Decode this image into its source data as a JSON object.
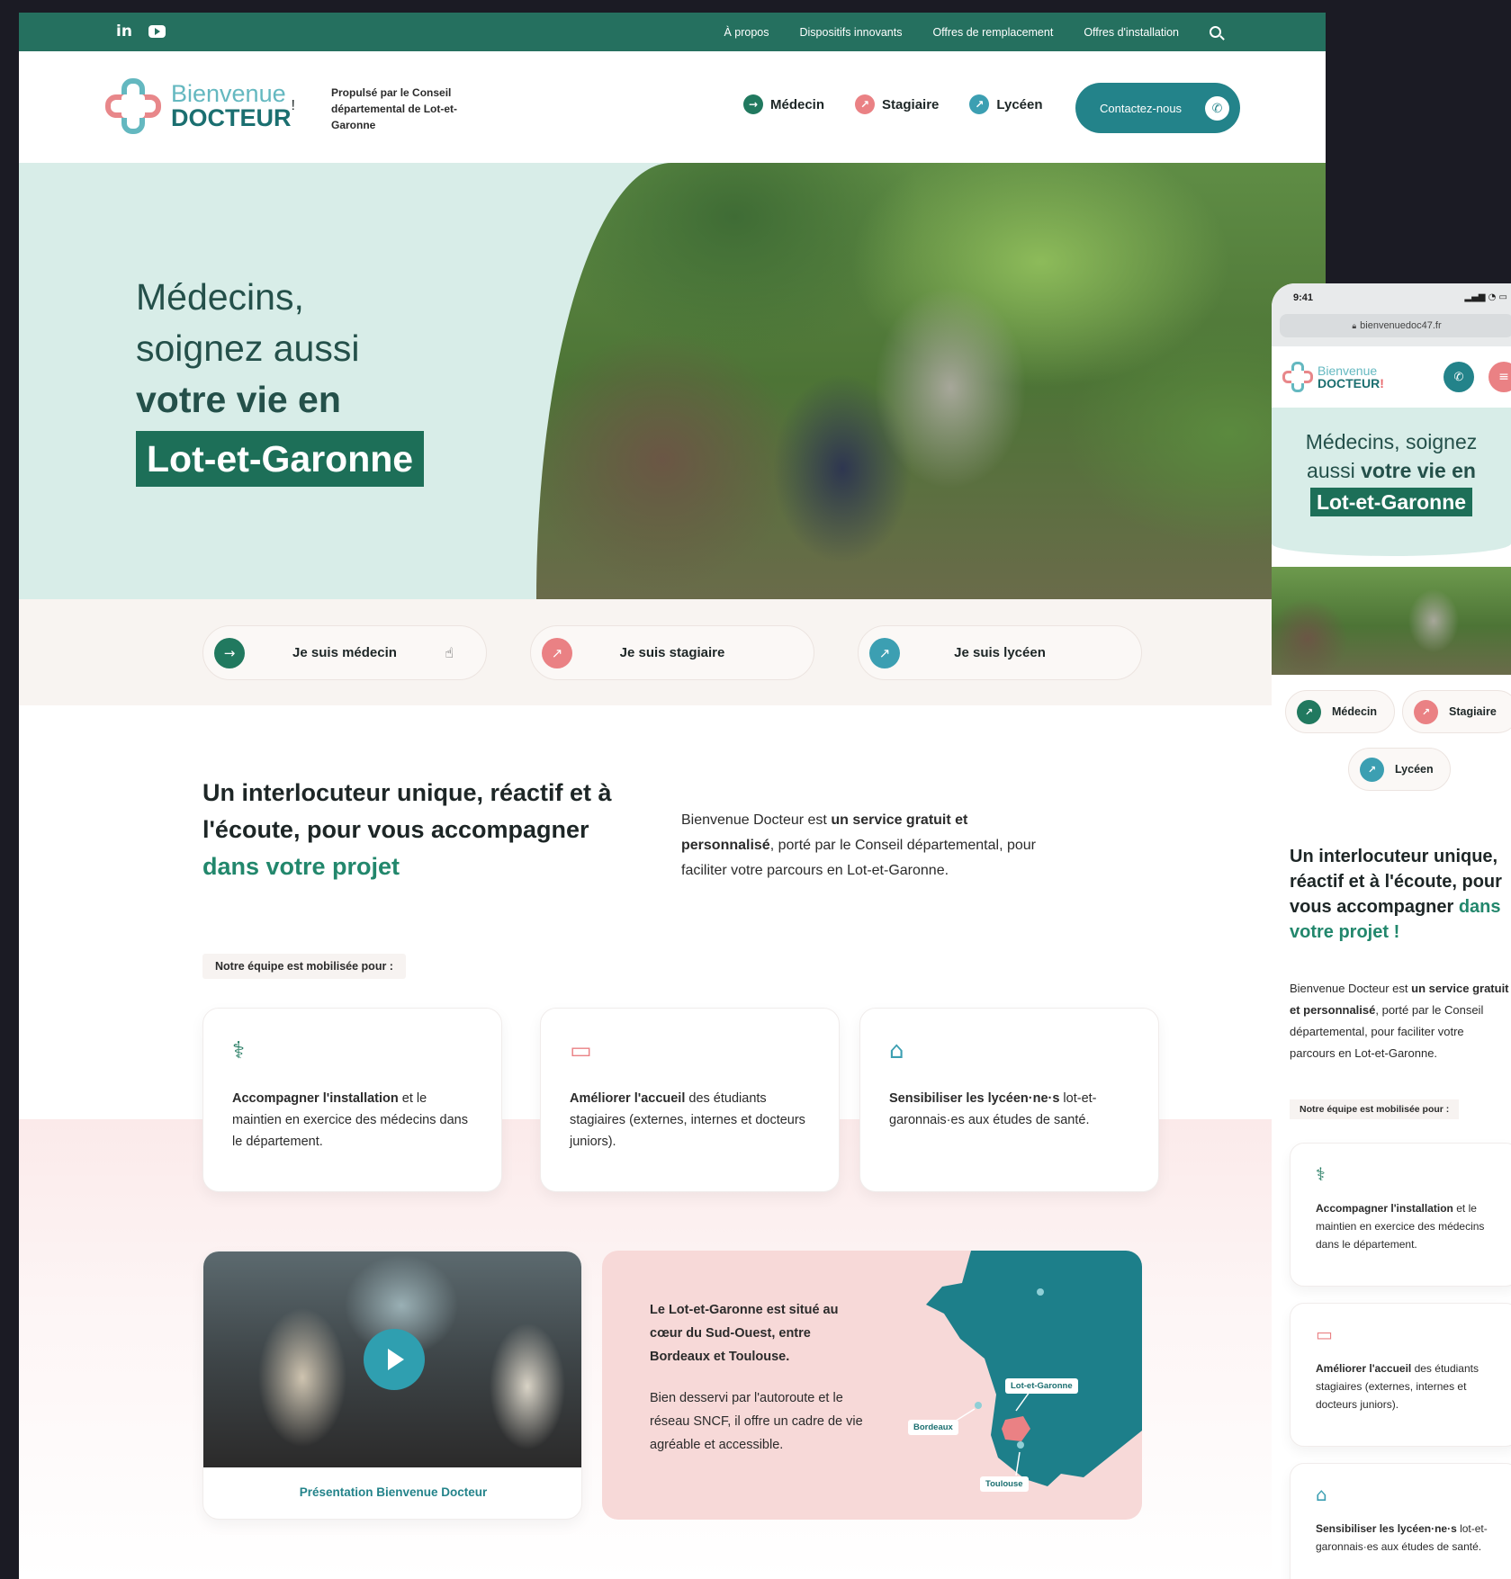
{
  "desktop": {
    "topbar": {
      "social": [
        "in",
        "youtube"
      ],
      "nav": [
        "À propos",
        "Dispositifs innovants",
        "Offres de remplacement",
        "Offres d'installation"
      ]
    },
    "header": {
      "logo_line1": "Bienvenue",
      "logo_line2": "DOCTEUR",
      "logo_bang": "!",
      "powered_by": "Propulsé par le Conseil départemental de Lot-et-Garonne",
      "nav": [
        {
          "label": "Médecin",
          "icon": "arrow-right-icon"
        },
        {
          "label": "Stagiaire",
          "icon": "arrow-up-right-icon"
        },
        {
          "label": "Lycéen",
          "icon": "arrow-up-right-icon"
        }
      ],
      "contact_label": "Contactez-nous"
    },
    "hero": {
      "line1": "Médecins,",
      "line2": "soignez aussi",
      "line3": "votre vie en",
      "tag": "Lot-et-Garonne"
    },
    "profiles": [
      {
        "label": "Je suis médecin"
      },
      {
        "label": "Je suis stagiaire"
      },
      {
        "label": "Je suis lycéen"
      }
    ],
    "intro": {
      "heading_main": "Un interlocuteur unique, réactif et à l'écoute, pour vous accompagner ",
      "heading_accent": "dans votre projet",
      "p_part1": "Bienvenue Docteur est ",
      "p_bold": "un service gratuit et personnalisé",
      "p_part2": ", porté par le Conseil départemental, pour faciliter votre parcours en Lot-et-Garonne."
    },
    "mobilised_label": "Notre équipe est mobilisée pour :",
    "cards": [
      {
        "icon": "stethoscope-icon",
        "bold": "Accompagner l'installation",
        "rest": " et le maintien en exercice des médecins dans le département."
      },
      {
        "icon": "student-card-icon",
        "bold": "Améliorer l'accueil",
        "rest": " des étudiants stagiaires (externes, internes et docteurs juniors)."
      },
      {
        "icon": "backpack-icon",
        "bold": "Sensibiliser les lycéen·ne·s",
        "rest": " lot-et-garonnais·es aux études de santé."
      }
    ],
    "video_caption": "Présentation Bienvenue Docteur",
    "map": {
      "text1": "Le Lot-et-Garonne est situé au cœur du Sud-Ouest, entre Bordeaux et Toulouse.",
      "text2": "Bien desservi par l'autoroute et le réseau SNCF, il offre un cadre de vie agréable et accessible.",
      "tags": [
        "Lot-et-Garonne",
        "Bordeaux",
        "Toulouse"
      ],
      "colors": {
        "land": "#1d7f8a",
        "region": "#ea8184"
      }
    }
  },
  "mobile": {
    "time": "9:41",
    "url": "bienvenuedoc47.fr",
    "logo_line1": "Bienvenue",
    "logo_line2": "DOCTEUR",
    "hero_line1": "Médecins, soignez",
    "hero_line2a": "aussi ",
    "hero_line2b": "votre vie en",
    "hero_tag": "Lot-et-Garonne",
    "pills": [
      "Médecin",
      "Stagiaire",
      "Lycéen"
    ],
    "intro_heading_main": "Un interlocuteur unique, réactif et à l'écoute, pour vous accompagner ",
    "intro_heading_accent": "dans votre projet !",
    "intro_p1": "Bienvenue Docteur est ",
    "intro_bold": "un service gratuit et personnalisé",
    "intro_p2": ", porté par le Conseil départemental, pour faciliter votre parcours en Lot-et-Garonne.",
    "mobilised_label": "Notre équipe est mobilisée pour :",
    "cards": [
      {
        "bold": "Accompagner l'installation",
        "rest": " et le maintien en exercice des médecins dans le département."
      },
      {
        "bold": "Améliorer l'accueil",
        "rest": " des étudiants stagiaires (externes, internes et docteurs juniors)."
      },
      {
        "bold": "Sensibiliser les lycéen·ne·s",
        "rest": " lot-et-garonnais·es aux études de santé."
      }
    ]
  },
  "colors": {
    "brand_green": "#25705f",
    "teal": "#23838a",
    "pink": "#ea8184",
    "mint": "#d8ede8"
  }
}
